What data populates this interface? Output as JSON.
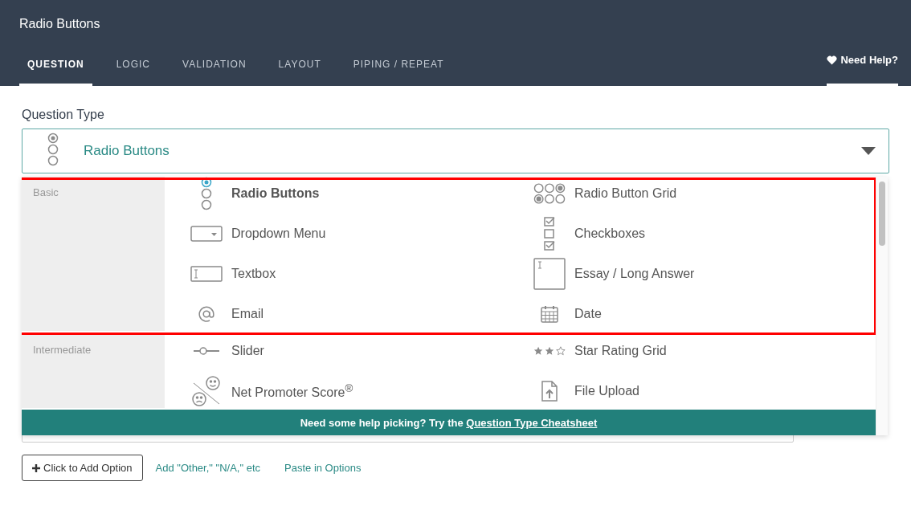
{
  "header": {
    "title": "Radio Buttons",
    "tabs": [
      {
        "label": "QUESTION",
        "selected": true
      },
      {
        "label": "LOGIC",
        "selected": false
      },
      {
        "label": "VALIDATION",
        "selected": false
      },
      {
        "label": "LAYOUT",
        "selected": false
      },
      {
        "label": "PIPING / REPEAT",
        "selected": false
      }
    ],
    "help": {
      "label": "Need Help?"
    }
  },
  "question_type": {
    "label": "Question Type",
    "value": {
      "label": "Radio Buttons",
      "kind": "radio"
    },
    "dropdown": {
      "sections": [
        {
          "category": "Basic",
          "items": [
            {
              "label": "Radio Buttons",
              "kind": "radio",
              "selected": true
            },
            {
              "label": "Radio Button Grid",
              "kind": "radio-grid",
              "selected": false
            },
            {
              "label": "Dropdown Menu",
              "kind": "dropdown",
              "selected": false
            },
            {
              "label": "Checkboxes",
              "kind": "checkboxes",
              "selected": false
            },
            {
              "label": "Textbox",
              "kind": "textbox",
              "selected": false
            },
            {
              "label": "Essay / Long Answer",
              "kind": "essay",
              "selected": false
            },
            {
              "label": "Email",
              "kind": "email",
              "selected": false
            },
            {
              "label": "Date",
              "kind": "date",
              "selected": false
            }
          ]
        },
        {
          "category": "Intermediate",
          "items": [
            {
              "label": "Slider",
              "kind": "slider",
              "selected": false
            },
            {
              "label": "Star Rating Grid",
              "kind": "star-grid",
              "selected": false
            },
            {
              "label": "Net Promoter Score$^{®}$",
              "kind": "nps",
              "selected": false
            },
            {
              "label": "File Upload",
              "kind": "file-upload",
              "selected": false
            }
          ]
        }
      ],
      "help_text": "Need some help picking? Try the ",
      "help_link": "Question Type Cheatsheet"
    }
  },
  "option_actions": {
    "add_button": "Click to Add Option",
    "links": [
      "Add \"Other,\" \"N/A,\" etc",
      "Paste in Options"
    ]
  }
}
